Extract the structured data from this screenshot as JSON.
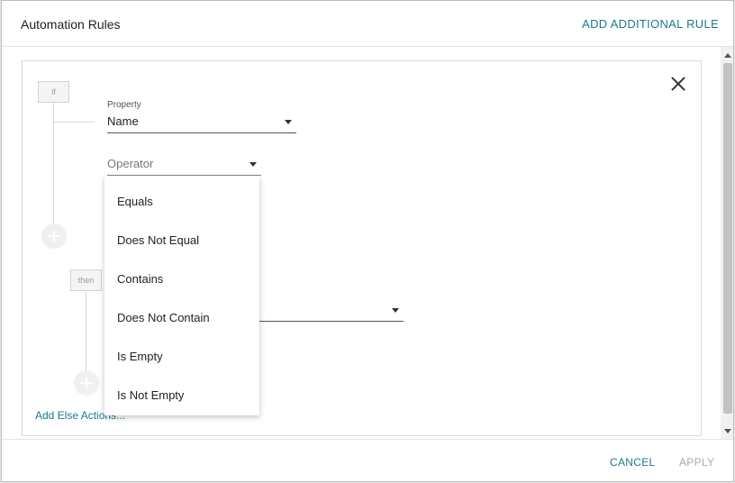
{
  "header": {
    "title": "Automation Rules",
    "add_rule_label": "ADD ADDITIONAL RULE"
  },
  "rule": {
    "if_tag": "if",
    "then_tag": "then",
    "property": {
      "label": "Property",
      "value": "Name"
    },
    "operator": {
      "placeholder": "Operator",
      "options": [
        "Equals",
        "Does Not Equal",
        "Contains",
        "Does Not Contain",
        "Is Empty",
        "Is Not Empty"
      ]
    },
    "add_else_label": "Add Else Actions..."
  },
  "footer": {
    "cancel_label": "CANCEL",
    "apply_label": "APPLY"
  },
  "colors": {
    "accent": "#1b7a8c",
    "disabled": "#a9a9a9"
  },
  "icons": {
    "close": "close-icon",
    "add": "plus-circle-icon",
    "caret": "caret-down-icon"
  }
}
